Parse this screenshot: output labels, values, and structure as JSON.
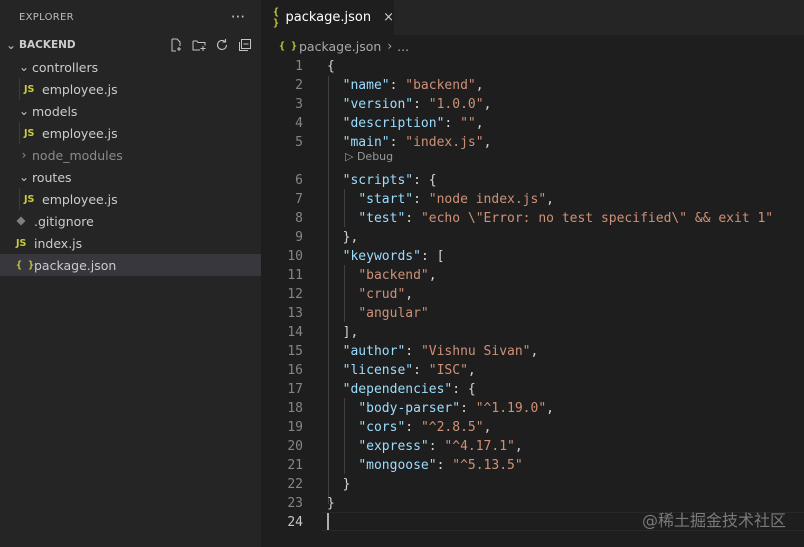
{
  "explorer": {
    "title": "EXPLORER",
    "more": "···",
    "folder": "BACKEND",
    "items": [
      {
        "label": "controllers",
        "type": "folder"
      },
      {
        "label": "employee.js",
        "type": "js"
      },
      {
        "label": "models",
        "type": "folder"
      },
      {
        "label": "employee.js",
        "type": "js"
      },
      {
        "label": "node_modules",
        "type": "folder-collapsed"
      },
      {
        "label": "routes",
        "type": "folder"
      },
      {
        "label": "employee.js",
        "type": "js"
      },
      {
        "label": ".gitignore",
        "type": "git"
      },
      {
        "label": "index.js",
        "type": "js"
      },
      {
        "label": "package.json",
        "type": "json"
      }
    ],
    "icons": {
      "js": "JS",
      "json": "{ }"
    }
  },
  "tab": {
    "label": "package.json",
    "close": "×",
    "icon": "{ }"
  },
  "breadcrumb": {
    "file": "package.json",
    "sep": "›",
    "more": "..."
  },
  "editor": {
    "codelens": "▷ Debug",
    "line_numbers": [
      "1",
      "2",
      "3",
      "4",
      "5",
      "6",
      "7",
      "8",
      "9",
      "10",
      "11",
      "12",
      "13",
      "14",
      "15",
      "16",
      "17",
      "18",
      "19",
      "20",
      "21",
      "22",
      "23",
      "24"
    ],
    "lines": [
      [
        [
          "p",
          "{"
        ]
      ],
      [
        [
          "p",
          "  "
        ],
        [
          "k",
          "\"name\""
        ],
        [
          "p",
          ": "
        ],
        [
          "s",
          "\"backend\""
        ],
        [
          "p",
          ","
        ]
      ],
      [
        [
          "p",
          "  "
        ],
        [
          "k",
          "\"version\""
        ],
        [
          "p",
          ": "
        ],
        [
          "s",
          "\"1.0.0\""
        ],
        [
          "p",
          ","
        ]
      ],
      [
        [
          "p",
          "  "
        ],
        [
          "k",
          "\"description\""
        ],
        [
          "p",
          ": "
        ],
        [
          "s",
          "\"\""
        ],
        [
          "p",
          ","
        ]
      ],
      [
        [
          "p",
          "  "
        ],
        [
          "k",
          "\"main\""
        ],
        [
          "p",
          ": "
        ],
        [
          "s",
          "\"index.js\""
        ],
        [
          "p",
          ","
        ]
      ],
      [
        [
          "p",
          "  "
        ],
        [
          "k",
          "\"scripts\""
        ],
        [
          "p",
          ": {"
        ]
      ],
      [
        [
          "p",
          "    "
        ],
        [
          "k",
          "\"start\""
        ],
        [
          "p",
          ": "
        ],
        [
          "s",
          "\"node index.js\""
        ],
        [
          "p",
          ","
        ]
      ],
      [
        [
          "p",
          "    "
        ],
        [
          "k",
          "\"test\""
        ],
        [
          "p",
          ": "
        ],
        [
          "s",
          "\"echo \\\"Error: no test specified\\\" && exit 1\""
        ]
      ],
      [
        [
          "p",
          "  },"
        ]
      ],
      [
        [
          "p",
          "  "
        ],
        [
          "k",
          "\"keywords\""
        ],
        [
          "p",
          ": ["
        ]
      ],
      [
        [
          "p",
          "    "
        ],
        [
          "s",
          "\"backend\""
        ],
        [
          "p",
          ","
        ]
      ],
      [
        [
          "p",
          "    "
        ],
        [
          "s",
          "\"crud\""
        ],
        [
          "p",
          ","
        ]
      ],
      [
        [
          "p",
          "    "
        ],
        [
          "s",
          "\"angular\""
        ]
      ],
      [
        [
          "p",
          "  ],"
        ]
      ],
      [
        [
          "p",
          "  "
        ],
        [
          "k",
          "\"author\""
        ],
        [
          "p",
          ": "
        ],
        [
          "s",
          "\"Vishnu Sivan\""
        ],
        [
          "p",
          ","
        ]
      ],
      [
        [
          "p",
          "  "
        ],
        [
          "k",
          "\"license\""
        ],
        [
          "p",
          ": "
        ],
        [
          "s",
          "\"ISC\""
        ],
        [
          "p",
          ","
        ]
      ],
      [
        [
          "p",
          "  "
        ],
        [
          "k",
          "\"dependencies\""
        ],
        [
          "p",
          ": {"
        ]
      ],
      [
        [
          "p",
          "    "
        ],
        [
          "k",
          "\"body-parser\""
        ],
        [
          "p",
          ": "
        ],
        [
          "s",
          "\"^1.19.0\""
        ],
        [
          "p",
          ","
        ]
      ],
      [
        [
          "p",
          "    "
        ],
        [
          "k",
          "\"cors\""
        ],
        [
          "p",
          ": "
        ],
        [
          "s",
          "\"^2.8.5\""
        ],
        [
          "p",
          ","
        ]
      ],
      [
        [
          "p",
          "    "
        ],
        [
          "k",
          "\"express\""
        ],
        [
          "p",
          ": "
        ],
        [
          "s",
          "\"^4.17.1\""
        ],
        [
          "p",
          ","
        ]
      ],
      [
        [
          "p",
          "    "
        ],
        [
          "k",
          "\"mongoose\""
        ],
        [
          "p",
          ": "
        ],
        [
          "s",
          "\"^5.13.5\""
        ]
      ],
      [
        [
          "p",
          "  }"
        ]
      ],
      [
        [
          "p",
          "}"
        ]
      ],
      [
        [
          "p",
          ""
        ]
      ]
    ]
  },
  "watermark": "@稀土掘金技术社区",
  "colors": {
    "key": "#9cdcfe",
    "string": "#ce9178",
    "punct": "#d4d4d4",
    "json_icon": "#cbcb41"
  }
}
